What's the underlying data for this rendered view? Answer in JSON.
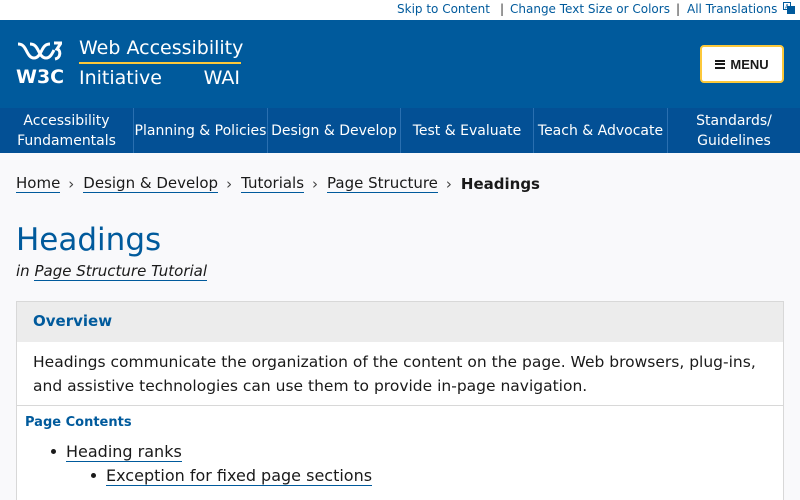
{
  "utility": {
    "skip": "Skip to Content",
    "text_size": "Change Text Size or Colors",
    "translations": "All Translations"
  },
  "header": {
    "logo_w3c": "W3C",
    "logo_line1": "Web Accessibility",
    "logo_line2": "Initiative",
    "logo_wai": "WAI",
    "menu_label": "MENU",
    "accent_color": "#fcc83b",
    "brand_color": "#005a9c"
  },
  "nav": [
    {
      "line1": "Accessibility",
      "line2": "Fundamentals"
    },
    {
      "line1": "Planning & Policies",
      "line2": ""
    },
    {
      "line1": "Design & Develop",
      "line2": ""
    },
    {
      "line1": "Test & Evaluate",
      "line2": ""
    },
    {
      "line1": "Teach & Advocate",
      "line2": ""
    },
    {
      "line1": "Standards/",
      "line2": "Guidelines"
    }
  ],
  "breadcrumb": {
    "items": [
      "Home",
      "Design & Develop",
      "Tutorials",
      "Page Structure"
    ],
    "current": "Headings"
  },
  "page": {
    "title": "Headings",
    "in_label": "in",
    "tutorial_link": "Page Structure Tutorial"
  },
  "overview": {
    "heading": "Overview",
    "body": "Headings communicate the organization of the content on the page. Web browsers, plug-ins, and assistive technologies can use them to provide in-page navigation."
  },
  "toc": {
    "heading": "Page Contents",
    "items": [
      "Heading ranks"
    ],
    "subitems": [
      "Exception for fixed page sections"
    ]
  }
}
